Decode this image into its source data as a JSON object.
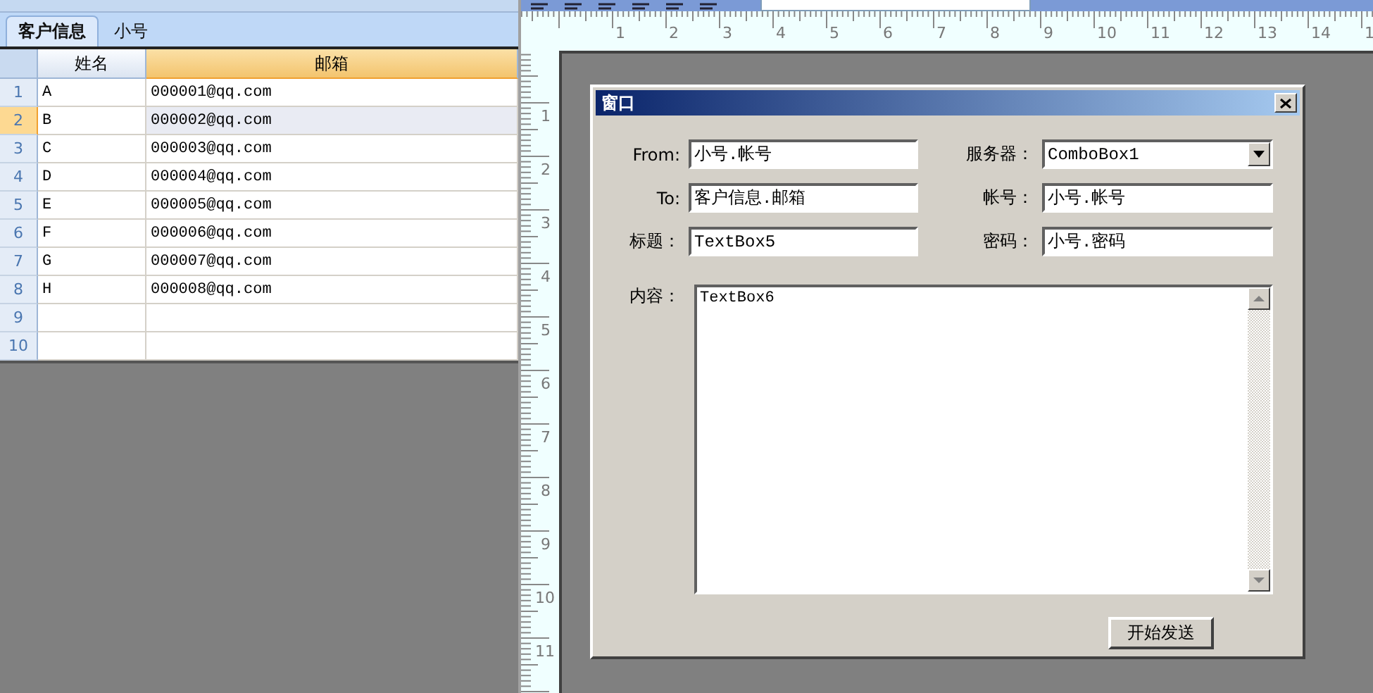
{
  "sheet_tabs": [
    {
      "label": "客户信息",
      "selected": true
    },
    {
      "label": "小号",
      "selected": false
    }
  ],
  "grid": {
    "columns": [
      {
        "label": "姓名",
        "selected": false
      },
      {
        "label": "邮箱",
        "selected": true
      }
    ],
    "rows": [
      {
        "number": "1",
        "cells": [
          "A",
          "000001@qq.com"
        ],
        "selected": false
      },
      {
        "number": "2",
        "cells": [
          "B",
          "000002@qq.com"
        ],
        "selected": true
      },
      {
        "number": "3",
        "cells": [
          "C",
          "000003@qq.com"
        ],
        "selected": false
      },
      {
        "number": "4",
        "cells": [
          "D",
          "000004@qq.com"
        ],
        "selected": false
      },
      {
        "number": "5",
        "cells": [
          "E",
          "000005@qq.com"
        ],
        "selected": false
      },
      {
        "number": "6",
        "cells": [
          "F",
          "000006@qq.com"
        ],
        "selected": false
      },
      {
        "number": "7",
        "cells": [
          "G",
          "000007@qq.com"
        ],
        "selected": false
      },
      {
        "number": "8",
        "cells": [
          "H",
          "000008@qq.com"
        ],
        "selected": false
      },
      {
        "number": "9",
        "cells": [],
        "selected": false
      },
      {
        "number": "10",
        "cells": [],
        "selected": false
      }
    ]
  },
  "ruler": {
    "horizontal": [
      "1",
      "2",
      "3",
      "4",
      "5",
      "6",
      "7",
      "8",
      "9",
      "10",
      "11",
      "12",
      "13",
      "14",
      "1"
    ],
    "vertical": [
      "1",
      "2",
      "3",
      "4",
      "5",
      "6",
      "7",
      "8",
      "9",
      "10",
      "11"
    ]
  },
  "form": {
    "title": "窗口",
    "fields": [
      {
        "label": "From:",
        "value": "小号.帐号",
        "kind": "text"
      },
      {
        "label": "服务器：",
        "value": "ComboBox1",
        "kind": "combo"
      },
      {
        "label": "To:",
        "value": "客户信息.邮箱",
        "kind": "text"
      },
      {
        "label": "帐号：",
        "value": "小号.帐号",
        "kind": "text"
      },
      {
        "label": "标题：",
        "value": "TextBox5",
        "kind": "text"
      },
      {
        "label": "密码：",
        "value": "小号.密码",
        "kind": "text"
      }
    ],
    "content": {
      "label": "内容：",
      "value": "TextBox6"
    },
    "button": "开始发送"
  }
}
